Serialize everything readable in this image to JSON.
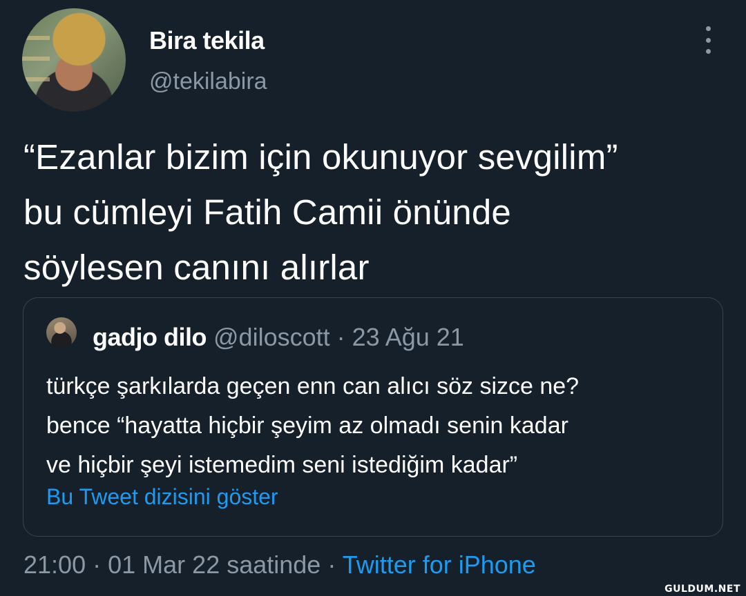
{
  "author": {
    "display_name": "Bira tekila",
    "handle": "@tekilabira",
    "avatar_icon": "profile-photo"
  },
  "more_icon": "more-vertical-icon",
  "tweet": {
    "line1": "“Ezanlar bizim için okunuyor sevgilim”",
    "line2": "bu cümleyi Fatih Camii önünde",
    "line3": "söylesen canını alırlar"
  },
  "quoted": {
    "display_name": "gadjo dilo",
    "handle": "@diloscott",
    "separator": "·",
    "date": "23 Ağu 21",
    "line1": "türkçe şarkılarda geçen enn can alıcı söz sizce ne?",
    "line2": "bence “hayatta hiçbir şeyim az olmadı senin kadar",
    "line3": "ve hiçbir şeyi istemedim seni istediğim kadar”",
    "show_thread": "Bu Tweet dizisini göster"
  },
  "footer": {
    "time": "21:00",
    "sep1": "·",
    "date": "01 Mar 22 saatinde",
    "sep2": "·",
    "source": "Twitter for iPhone"
  },
  "watermark": "GULDUM.NET",
  "colors": {
    "background": "#15202b",
    "text": "#ffffff",
    "secondary": "#8b98a5",
    "link": "#1d9bf0",
    "border": "#38444d"
  }
}
